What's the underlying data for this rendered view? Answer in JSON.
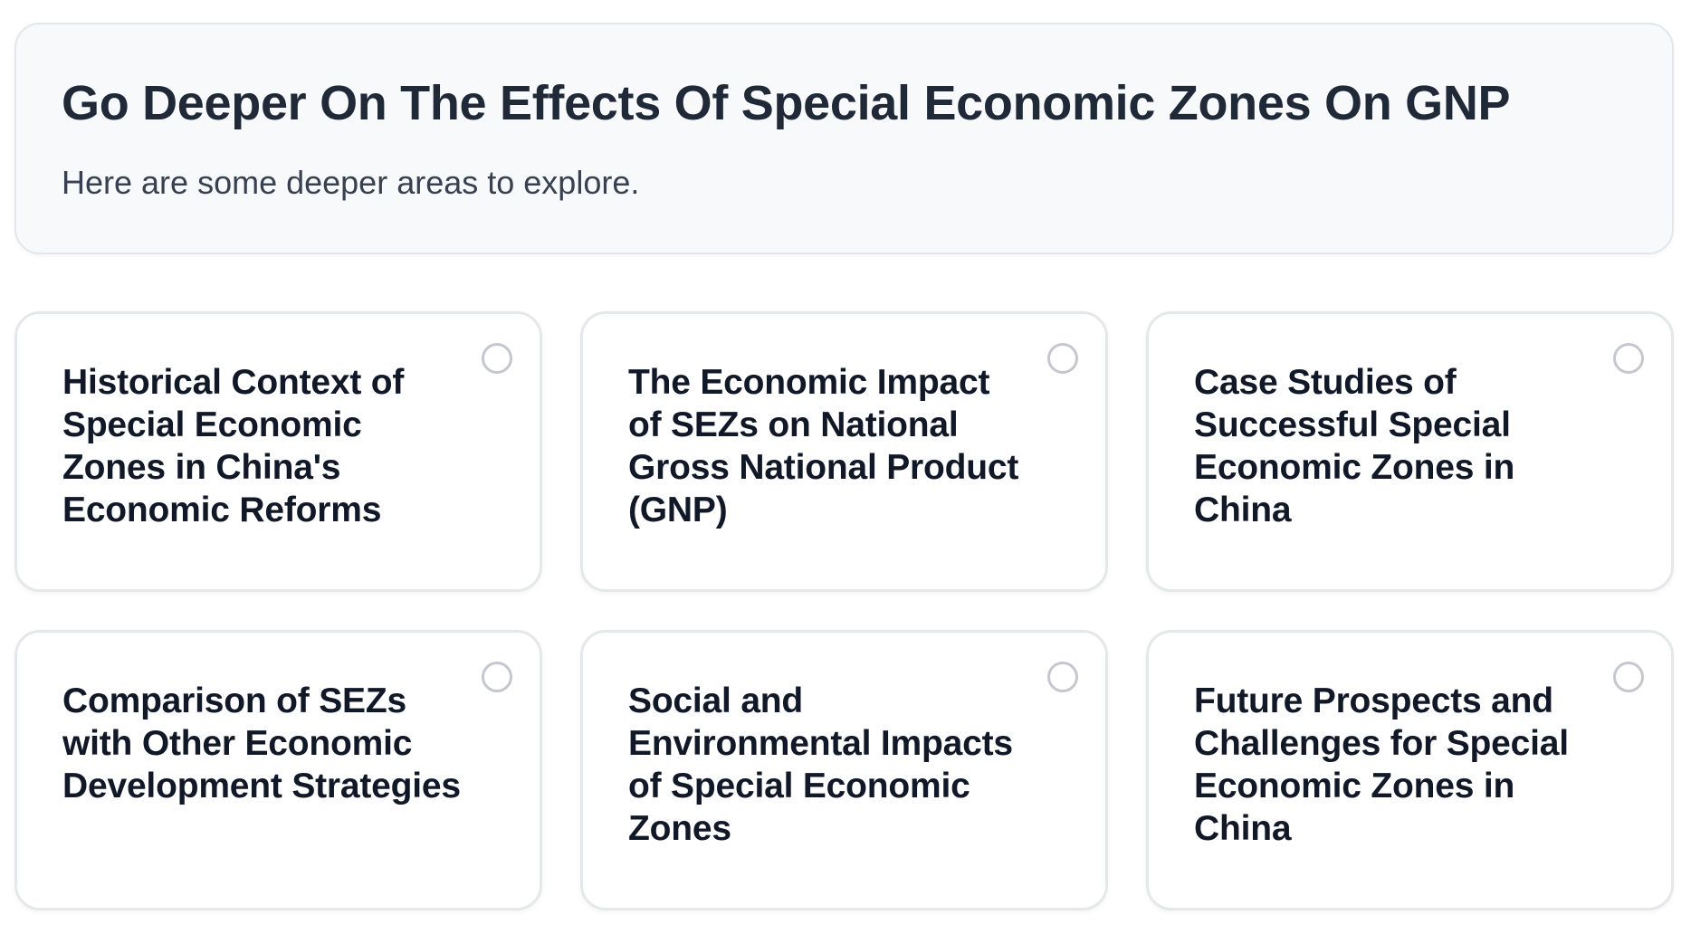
{
  "header": {
    "title": "Go Deeper On The Effects Of Special Economic Zones On GNP",
    "subtitle": "Here are some deeper areas to explore."
  },
  "options": [
    {
      "label": "Historical Context of Special Economic Zones in China's Economic Reforms",
      "selected": false
    },
    {
      "label": "The Economic Impact of SEZs on National Gross National Product (GNP)",
      "selected": false
    },
    {
      "label": "Case Studies of Successful Special Economic Zones in China",
      "selected": false
    },
    {
      "label": "Comparison of SEZs with Other Economic Development Strategies",
      "selected": false
    },
    {
      "label": "Social and Environmental Impacts of Special Economic Zones",
      "selected": false
    },
    {
      "label": "Future Prospects and Challenges for Special Economic Zones in China",
      "selected": false
    }
  ]
}
